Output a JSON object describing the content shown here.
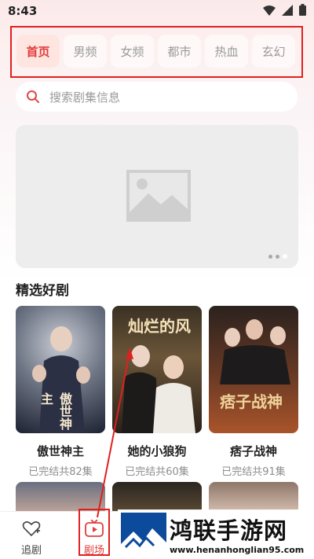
{
  "status": {
    "time": "8:43"
  },
  "tabs": [
    {
      "label": "首页",
      "active": true
    },
    {
      "label": "男频"
    },
    {
      "label": "女频"
    },
    {
      "label": "都市"
    },
    {
      "label": "热血"
    },
    {
      "label": "玄幻"
    }
  ],
  "search": {
    "placeholder": "搜索剧集信息"
  },
  "banner": {
    "dots": 3,
    "active_dot": 3
  },
  "section": {
    "title": "精选好剧"
  },
  "cards": [
    {
      "title": "傲世神主",
      "sub": "已完结共82集",
      "poster_text": "傲世神主"
    },
    {
      "title": "她的小狼狗",
      "sub": "已完结共60集",
      "poster_text": "灿烂的风"
    },
    {
      "title": "痞子战神",
      "sub": "已完结共91集",
      "poster_text": "痞子战神"
    }
  ],
  "nav": [
    {
      "label": "追剧",
      "active": false
    },
    {
      "label": "剧场",
      "active": true
    }
  ],
  "watermark": {
    "title": "鸿联手游网",
    "url": "www.henanhonglian95.com"
  },
  "colors": {
    "accent": "#e33c3c",
    "annotation": "#e02020"
  }
}
